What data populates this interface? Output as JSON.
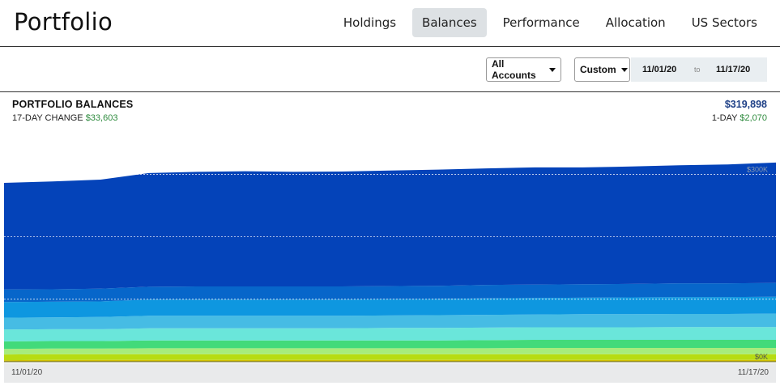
{
  "header": {
    "title": "Portfolio",
    "tabs": [
      {
        "label": "Holdings",
        "active": false
      },
      {
        "label": "Balances",
        "active": true
      },
      {
        "label": "Performance",
        "active": false
      },
      {
        "label": "Allocation",
        "active": false
      },
      {
        "label": "US Sectors",
        "active": false
      }
    ]
  },
  "controls": {
    "accounts_label": "All Accounts",
    "range_label": "Custom",
    "date_from": "11/01/20",
    "date_to_sep": "to",
    "date_to": "11/17/20"
  },
  "summary": {
    "title": "PORTFOLIO BALANCES",
    "change_label": "17-DAY CHANGE",
    "change_value": "$33,603",
    "total": "$319,898",
    "day_label": "1-DAY",
    "day_value": "$2,070"
  },
  "colors": {
    "positive": "#2e8b3e",
    "total": "#1d3f86",
    "active_tab_bg": "#dde1e4"
  },
  "chart_data": {
    "type": "area",
    "stacked": true,
    "x": [
      "11/01/20",
      "11/17/20"
    ],
    "x_tick_labels": [
      "11/01/20",
      "11/17/20"
    ],
    "y_tick_labels": [
      "$300K",
      "$0K"
    ],
    "ylim": [
      0,
      320000
    ],
    "grid": true,
    "series": [
      {
        "color": "#d2c200",
        "values": [
          2500,
          3000,
          3000,
          3000,
          3000,
          3000,
          3000,
          3000,
          3000,
          3000,
          3000,
          3000,
          3000,
          3000,
          3000,
          3000,
          3000
        ]
      },
      {
        "color": "#b7dc12",
        "values": [
          9000,
          9000,
          9000,
          9000,
          9000,
          9000,
          9000,
          9000,
          9000,
          9000,
          9000,
          9000,
          9000,
          9000,
          9000,
          9000,
          9000
        ]
      },
      {
        "color": "#a7ec7c",
        "values": [
          9000,
          9000,
          9000,
          9500,
          9500,
          9500,
          9500,
          9500,
          9500,
          9500,
          9500,
          10000,
          10000,
          10000,
          10000,
          10000,
          10000
        ]
      },
      {
        "color": "#42da7a",
        "values": [
          12000,
          12000,
          12000,
          12500,
          12500,
          12500,
          12500,
          12500,
          12500,
          12500,
          13000,
          13000,
          13000,
          13000,
          13000,
          13000,
          13000
        ]
      },
      {
        "color": "#6ae6da",
        "values": [
          19000,
          19000,
          19000,
          19500,
          19500,
          19500,
          19500,
          19500,
          20000,
          20000,
          20000,
          20000,
          20000,
          20000,
          20500,
          20500,
          20500
        ]
      },
      {
        "color": "#46bce4",
        "values": [
          19000,
          19000,
          19500,
          20000,
          20000,
          20000,
          20000,
          20000,
          20000,
          20500,
          20500,
          20500,
          21000,
          21000,
          21000,
          21000,
          21500
        ]
      },
      {
        "color": "#0e97e0",
        "values": [
          25000,
          25000,
          25000,
          26000,
          26000,
          26000,
          26000,
          26000,
          26000,
          26000,
          26500,
          26500,
          26500,
          27000,
          27000,
          27000,
          27000
        ]
      },
      {
        "color": "#0766ca",
        "values": [
          20000,
          20000,
          20500,
          20500,
          21000,
          21000,
          21000,
          21000,
          21000,
          21000,
          21500,
          21500,
          21500,
          21500,
          22000,
          22000,
          22000
        ]
      },
      {
        "color": "#0443b9",
        "values": [
          170795,
          172500,
          174500,
          182000,
          183500,
          184500,
          183500,
          184000,
          185000,
          186000,
          186500,
          187500,
          187000,
          188000,
          189000,
          190331,
          192898
        ]
      }
    ]
  }
}
